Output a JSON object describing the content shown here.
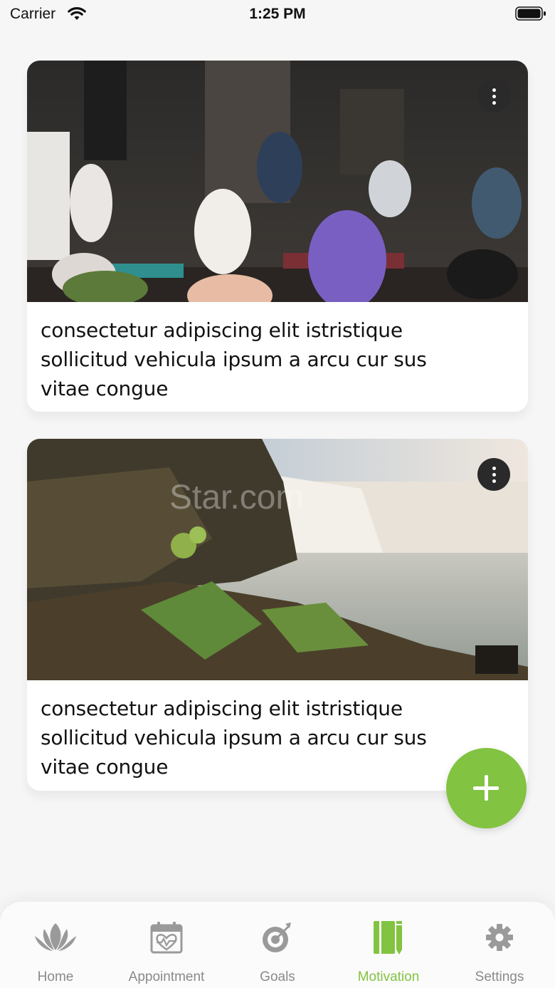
{
  "status_bar": {
    "carrier": "Carrier",
    "time": "1:25 PM"
  },
  "cards": [
    {
      "image": "yoga-class-photo",
      "text": "consectetur adipiscing elit istristique sollicitud vehicula ipsum a arcu cur sus vitae congue"
    },
    {
      "image": "waterfall-landscape-photo",
      "watermark": "Star.com",
      "text": "consectetur adipiscing elit istristique sollicitud vehicula ipsum a arcu cur sus vitae congue"
    }
  ],
  "fab": {
    "icon": "plus-icon"
  },
  "tabs": [
    {
      "label": "Home",
      "icon": "lotus-icon"
    },
    {
      "label": "Appointment",
      "icon": "calendar-heart-icon"
    },
    {
      "label": "Goals",
      "icon": "target-icon"
    },
    {
      "label": "Motivation",
      "icon": "notebook-pencil-icon",
      "active": true
    },
    {
      "label": "Settings",
      "icon": "gear-icon"
    }
  ],
  "colors": {
    "accent": "#82c341",
    "background": "#f6f6f6",
    "tab_inactive": "#8a8a8a"
  }
}
